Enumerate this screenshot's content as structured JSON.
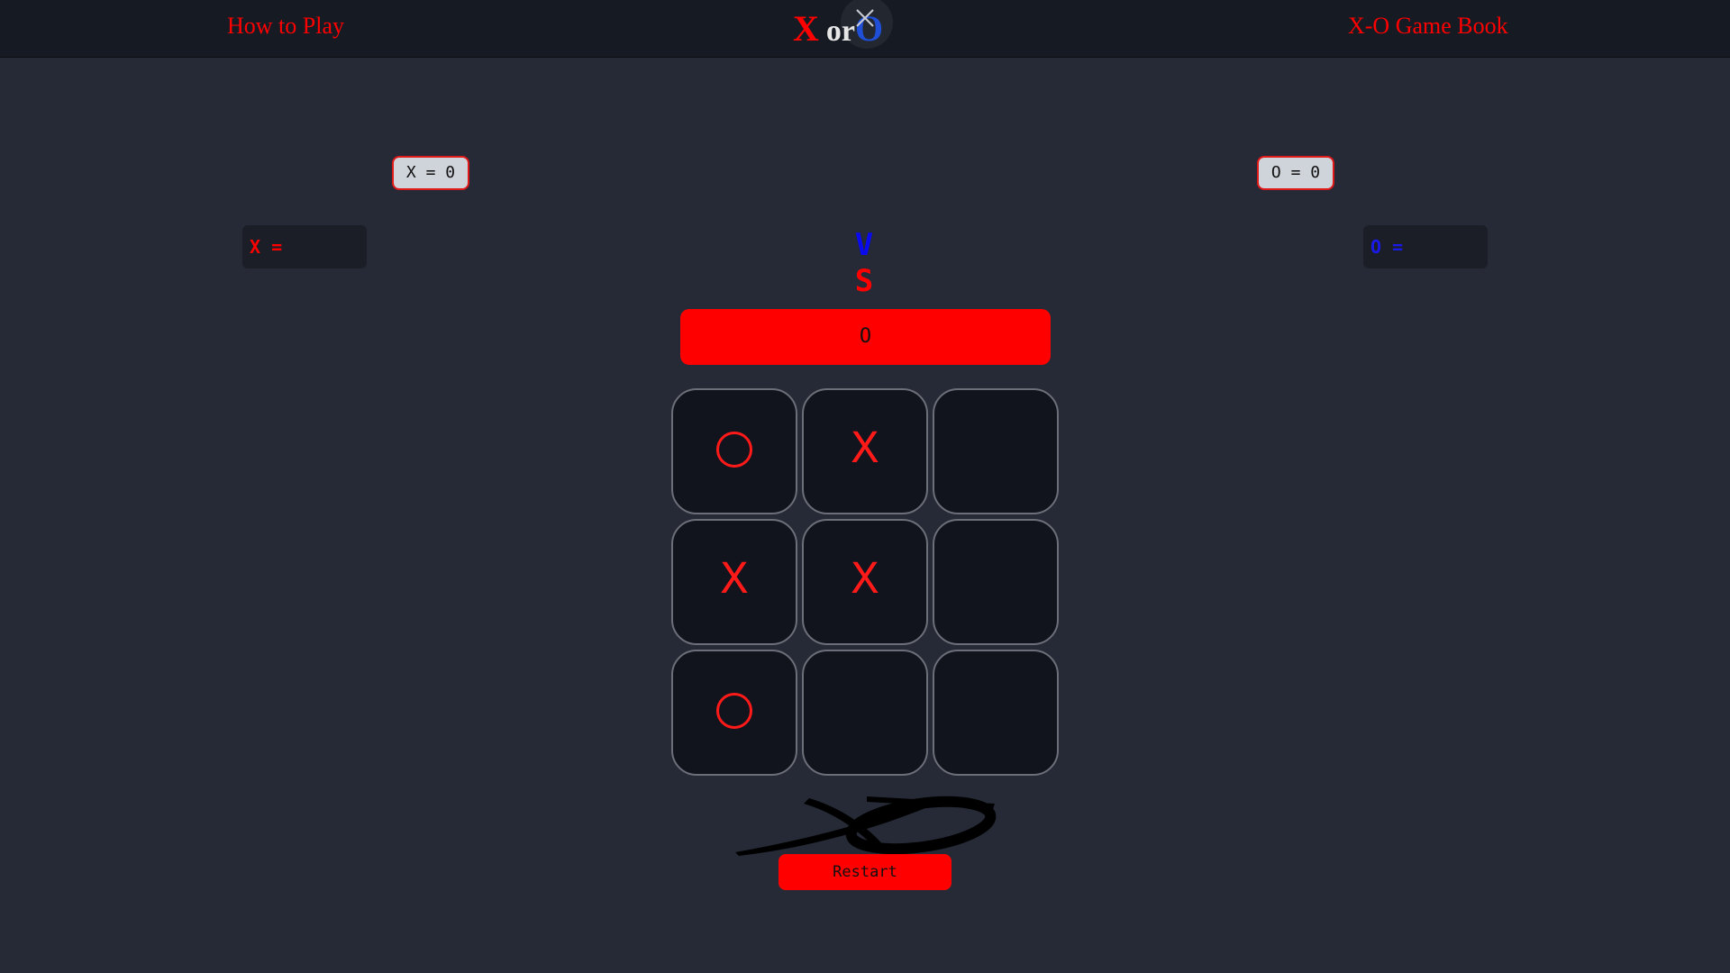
{
  "nav": {
    "how_to_play": "How to Play",
    "game_book": "X-O Game Book"
  },
  "logo": {
    "x": "X",
    "or": "or",
    "o": "O"
  },
  "scores": {
    "x_label": "X = 0",
    "o_label": "O = 0"
  },
  "players": {
    "x_name_label": "X =",
    "o_name_label": "O ="
  },
  "vs": {
    "v": "V",
    "s": "S"
  },
  "turn": {
    "current": "O"
  },
  "board": {
    "cells": [
      "O",
      "X",
      "",
      "X",
      "X",
      "",
      "O",
      "",
      ""
    ]
  },
  "restart_label": "Restart",
  "colors": {
    "background": "#252a36",
    "topbar": "#161a23",
    "accent_red": "#ff0000",
    "accent_blue": "#1a1ae6",
    "cell_bg": "#11141c"
  },
  "icons": {
    "close": "close-icon",
    "brush_logo": "xo-brush-logo"
  }
}
